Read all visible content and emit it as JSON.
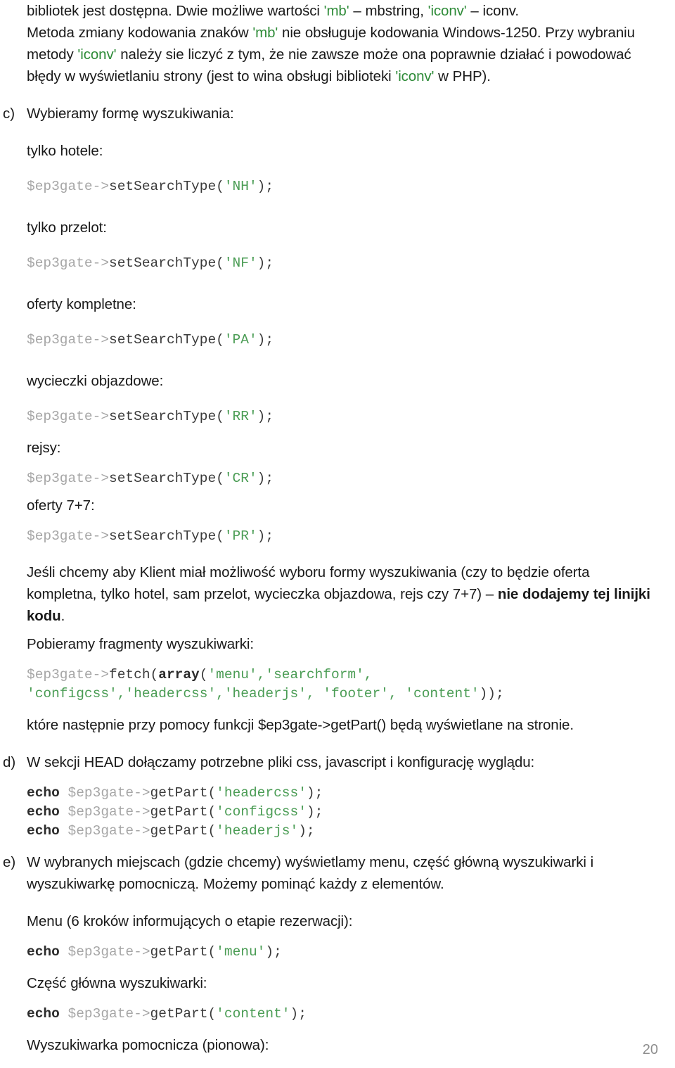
{
  "document": {
    "page_number": "20",
    "language": "pl"
  },
  "intro": {
    "line1_a": "bibliotek jest dostępna. Dwie możliwe wartości ",
    "line1_lit1": "'mb'",
    "line1_b": " – mbstring, ",
    "line1_lit2": "'iconv'",
    "line1_c": " – iconv.",
    "line2_a": "Metoda zmiany kodowania znaków ",
    "line2_lit1": "'mb'",
    "line2_b": " nie obsługuje kodowania Windows-1250. Przy wybraniu metody ",
    "line2_lit2": "'iconv'",
    "line2_c": " należy sie liczyć z tym, że nie zawsze może ona poprawnie działać i powodować błędy w wyświetlaniu strony (jest to wina obsługi biblioteki ",
    "line2_lit3": "'iconv'",
    "line2_d": " w PHP)."
  },
  "section_c": {
    "marker": "c)",
    "heading": "Wybieramy formę wyszukiwania:",
    "variants": [
      {
        "label": "tylko hotele:",
        "code": {
          "var": "$ep3gate->",
          "fn": "setSearchType(",
          "str": "'NH'",
          "tail": ");"
        }
      },
      {
        "label": "tylko przelot:",
        "code": {
          "var": "$ep3gate->",
          "fn": "setSearchType(",
          "str": "'NF'",
          "tail": ");"
        }
      },
      {
        "label": "oferty kompletne:",
        "code": {
          "var": "$ep3gate->",
          "fn": "setSearchType(",
          "str": "'PA'",
          "tail": ");"
        }
      },
      {
        "label": "wycieczki objazdowe:",
        "code": {
          "var": "$ep3gate->",
          "fn": "setSearchType(",
          "str": "'RR'",
          "tail": ");"
        }
      },
      {
        "label": "rejsy:",
        "code": {
          "var": "$ep3gate->",
          "fn": "setSearchType(",
          "str": "'CR'",
          "tail": ");"
        }
      },
      {
        "label": "oferty 7+7:",
        "code": {
          "var": "$ep3gate->",
          "fn": "setSearchType(",
          "str": "'PR'",
          "tail": ");"
        }
      }
    ],
    "note_a": "Jeśli chcemy aby Klient miał możliwość wyboru formy wyszukiwania (czy to będzie oferta kompletna, tylko hotel, sam przelot, wycieczka objazdowa, rejs czy 7+7) – ",
    "note_bold": "nie dodajemy tej linijki kodu",
    "note_b": ".",
    "fetch_heading": "Pobieramy fragmenty wyszukiwarki:",
    "fetch_code": {
      "var": "$ep3gate->",
      "fn": "fetch(",
      "kw": "array",
      "open": "(",
      "args_line1": "'menu','searchform',",
      "args_line2": "'configcss','headercss','headerjs', 'footer', 'content'",
      "tail": "));"
    },
    "fetch_after": "które następnie przy pomocy funkcji $ep3gate->getPart() będą wyświetlane na stronie."
  },
  "section_d": {
    "marker": "d)",
    "heading": "W sekcji HEAD dołączamy potrzebne pliki css, javascript i konfigurację wyglądu:",
    "lines": [
      {
        "kw": "echo",
        "var": " $ep3gate->",
        "fn": "getPart(",
        "str": "'headercss'",
        "tail": ");"
      },
      {
        "kw": "echo",
        "var": " $ep3gate->",
        "fn": "getPart(",
        "str": "'configcss'",
        "tail": ");"
      },
      {
        "kw": "echo",
        "var": " $ep3gate->",
        "fn": "getPart(",
        "str": "'headerjs'",
        "tail": ");"
      }
    ]
  },
  "section_e": {
    "marker": "e)",
    "heading": "W wybranych miejscach (gdzie chcemy) wyświetlamy menu, część główną wyszukiwarki i wyszukiwarkę pomocniczą. Możemy pominąć każdy z elementów.",
    "menu_label": "Menu (6 kroków informujących o etapie rezerwacji):",
    "menu_code": {
      "kw": "echo",
      "var": " $ep3gate->",
      "fn": "getPart(",
      "str": "'menu'",
      "tail": ");"
    },
    "main_label": "Część główna wyszukiwarki:",
    "main_code": {
      "kw": "echo",
      "var": " $ep3gate->",
      "fn": "getPart(",
      "str": "'content'",
      "tail": ");"
    },
    "aux_label": "Wyszukiwarka pomocnicza (pionowa):"
  },
  "colors": {
    "text": "#1a1a1a",
    "code_variable": "#a6a6a6",
    "code_string": "#4a9c54",
    "code_function": "#3a3a3a",
    "inline_literal": "#2e8b38",
    "page_number": "#8e8e8e"
  }
}
